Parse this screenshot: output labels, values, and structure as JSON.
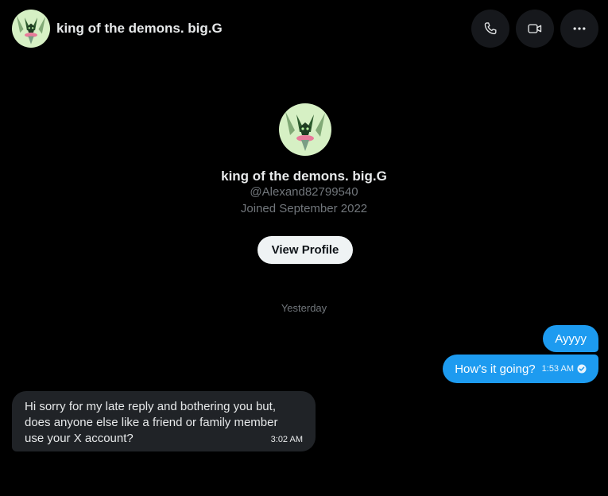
{
  "header": {
    "title": "king of the demons. big.G",
    "icons": {
      "call": "phone-icon",
      "video": "video-camera-icon",
      "more": "more-dots-icon"
    }
  },
  "profile": {
    "name": "king of the demons. big.G",
    "handle": "@Alexand82799540",
    "joined": "Joined September 2022",
    "view_profile_label": "View Profile"
  },
  "conversation": {
    "date_separator": "Yesterday",
    "messages": [
      {
        "direction": "outgoing",
        "text": "Ayyyy"
      },
      {
        "direction": "outgoing",
        "text": "How’s it going?",
        "time": "1:53 AM",
        "status": "seen"
      },
      {
        "direction": "incoming",
        "text": "Hi sorry for my late reply and bothering you but, does anyone else like a friend or family member use your X account?",
        "time": "3:02 AM"
      }
    ]
  },
  "colors": {
    "background": "#000000",
    "accent": "#1d9bf0",
    "incoming_bubble": "#202327",
    "muted_text": "#71767b"
  }
}
